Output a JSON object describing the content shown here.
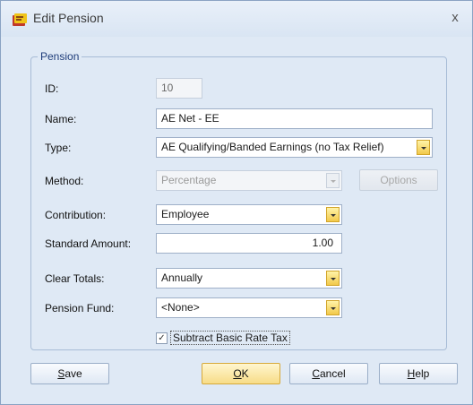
{
  "window": {
    "title": "Edit Pension",
    "close_glyph": "x"
  },
  "group": {
    "legend": "Pension"
  },
  "fields": {
    "id": {
      "label": "ID:",
      "value": "10"
    },
    "name": {
      "label": "Name:",
      "value": "AE Net - EE"
    },
    "type": {
      "label": "Type:",
      "value": "AE Qualifying/Banded Earnings (no Tax Relief)"
    },
    "method": {
      "label": "Method:",
      "value": "Percentage",
      "options_label": "Options"
    },
    "contribution": {
      "label": "Contribution:",
      "value": "Employee"
    },
    "standard_amount": {
      "label": "Standard Amount:",
      "value": "1.00"
    },
    "clear_totals": {
      "label": "Clear Totals:",
      "value": "Annually"
    },
    "pension_fund": {
      "label": "Pension Fund:",
      "value": "<None>"
    }
  },
  "checkbox": {
    "label": "Subtract Basic Rate Tax",
    "checked": true,
    "glyph": "✓"
  },
  "buttons": {
    "save": {
      "key": "S",
      "rest": "ave"
    },
    "ok": {
      "key": "O",
      "rest": "K"
    },
    "cancel": {
      "key": "C",
      "rest": "ancel"
    },
    "help": {
      "key": "H",
      "rest": "elp"
    }
  },
  "colors": {
    "accent_dropdown": "#f2c94a",
    "frame": "#dfe9f5"
  },
  "icons": {
    "app": "pension-app-icon",
    "close": "close-icon"
  }
}
